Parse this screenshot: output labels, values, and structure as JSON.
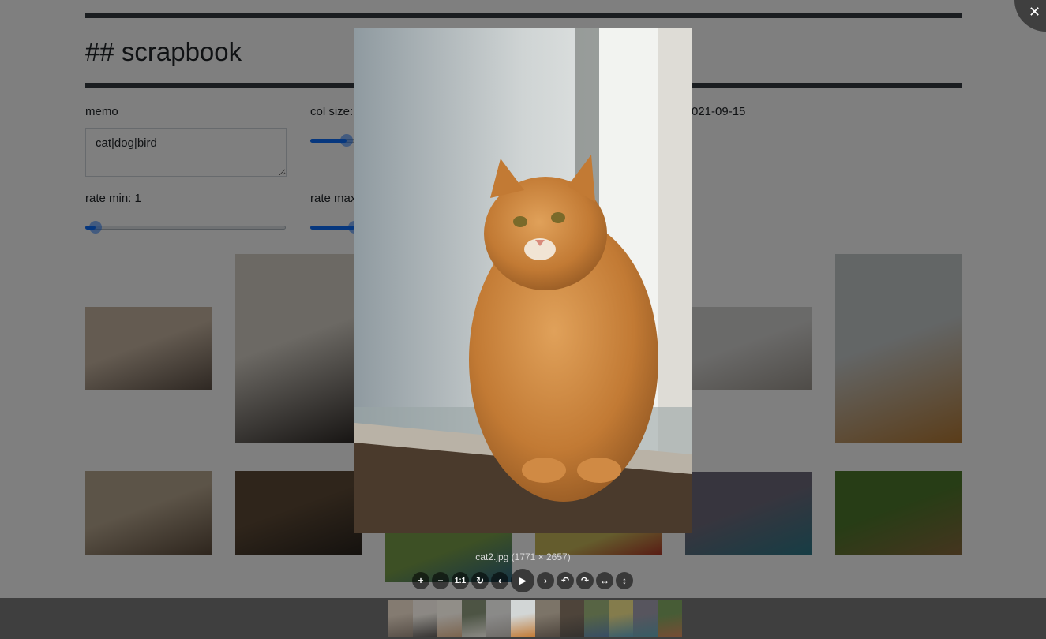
{
  "page": {
    "title": "## scrapbook",
    "memo_label": "memo",
    "memo_value": "cat|dog|bird",
    "col_size_label": "col size:",
    "date_label": "021-09-15",
    "rate_min_label": "rate min: 1",
    "rate_max_label": "rate max",
    "col_size_level": 0.16,
    "rate_min_level": 0.02,
    "rate_max_level": 0.2
  },
  "gallery": {
    "items": [
      {
        "name": "dog-sleeping-bed",
        "colors": [
          "#c9b7a3",
          "#5e5147"
        ]
      },
      {
        "name": "husky-puppy",
        "colors": [
          "#d8d2c8",
          "#2b2623"
        ]
      },
      {
        "name": "cat-lying-white",
        "colors": [
          "#d5d4d2",
          "#9e9890"
        ]
      },
      {
        "name": "orange-cat-window",
        "colors": [
          "#c7cccd",
          "#b57932"
        ]
      },
      {
        "name": "kitten-sleeping",
        "colors": [
          "#b9a890",
          "#5d4c3c"
        ]
      },
      {
        "name": "cat-standing-wood",
        "colors": [
          "#5e4a36",
          "#2a241e"
        ]
      },
      {
        "name": "hummingbird",
        "colors": [
          "#6f6b7d",
          "#2e7a8a"
        ]
      },
      {
        "name": "robin-branch",
        "colors": [
          "#4f7a2c",
          "#8a6a3e"
        ]
      },
      {
        "name": "bird-branch-green",
        "colors": [
          "#7aa04a",
          "#2f6b8a"
        ]
      },
      {
        "name": "bird-yellow-bg",
        "colors": [
          "#c9b95a",
          "#b23a2a"
        ]
      }
    ]
  },
  "viewer": {
    "caption": "cat2.jpg (1771 × 2657)",
    "image_name": "cat2.jpg",
    "colors": {
      "bg": "#cfd4d4",
      "cat": "#c27a34",
      "sill": "#4a3a2c"
    },
    "toolbar": {
      "zoom_in": "+",
      "zoom_out": "−",
      "one_to_one": "1:1",
      "reset": "↻",
      "prev": "‹",
      "play": "▶",
      "next": "›",
      "rotate_left": "↶",
      "rotate_right": "↷",
      "flip_h": "↔",
      "flip_v": "↕"
    },
    "close": "✕",
    "thumbnails": [
      {
        "colors": [
          "#c9b7a3",
          "#6e5d4e"
        ],
        "active": false
      },
      {
        "colors": [
          "#d8d2c8",
          "#2b2623"
        ],
        "active": false
      },
      {
        "colors": [
          "#e3dcd2",
          "#b8895c"
        ],
        "active": false
      },
      {
        "colors": [
          "#5b6a4a",
          "#d9d5cc"
        ],
        "active": false
      },
      {
        "colors": [
          "#d5d4d2",
          "#9e9890"
        ],
        "active": false
      },
      {
        "colors": [
          "#d2d6d6",
          "#c27a34"
        ],
        "active": true
      },
      {
        "colors": [
          "#b9a890",
          "#5d4c3c"
        ],
        "active": false
      },
      {
        "colors": [
          "#5e4a36",
          "#2a241e"
        ],
        "active": false
      },
      {
        "colors": [
          "#6f8a4a",
          "#2f5b8a"
        ],
        "active": false
      },
      {
        "colors": [
          "#c9b95a",
          "#2f7a9a"
        ],
        "active": false
      },
      {
        "colors": [
          "#6f6b7d",
          "#2e7a8a"
        ],
        "active": false
      },
      {
        "colors": [
          "#4f7a2c",
          "#b05a2a"
        ],
        "active": false
      }
    ]
  }
}
